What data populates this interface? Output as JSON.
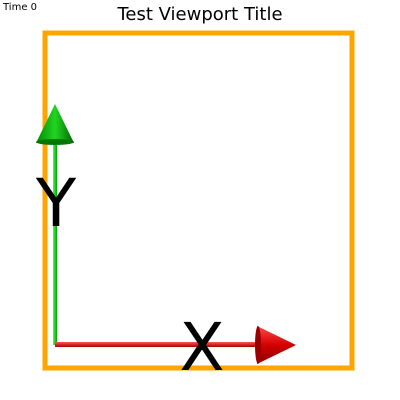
{
  "time_label": "Time 0",
  "title": "Test Viewport Title",
  "axes": {
    "x": {
      "label": "X",
      "color": "#e60000"
    },
    "y": {
      "label": "Y",
      "color": "#00cc00"
    }
  },
  "frame_color": "#ffa500"
}
